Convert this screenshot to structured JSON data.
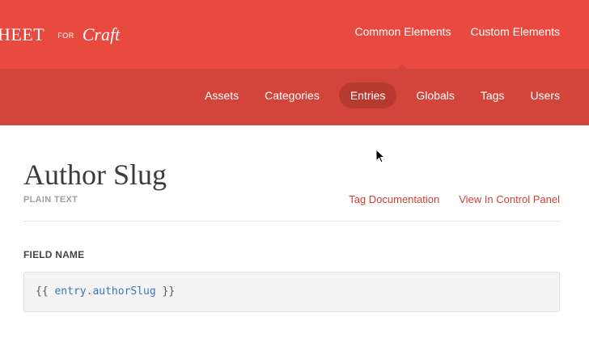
{
  "header": {
    "logo": {
      "main": "HEET",
      "for": "FOR",
      "craft": "Craft"
    },
    "nav": [
      {
        "label": "Common Elements"
      },
      {
        "label": "Custom Elements"
      }
    ]
  },
  "subnav": {
    "items": [
      {
        "label": "Assets"
      },
      {
        "label": "Categories"
      },
      {
        "label": "Entries",
        "active": true
      },
      {
        "label": "Globals"
      },
      {
        "label": "Tags"
      },
      {
        "label": "Users"
      }
    ]
  },
  "content": {
    "title": "Author Slug",
    "type": "PLAIN TEXT",
    "links": [
      {
        "label": "Tag Documentation"
      },
      {
        "label": "View In Control Panel"
      }
    ],
    "field_label": "FIELD NAME",
    "code": {
      "open": "{{",
      "expression": "entry.authorSlug",
      "close": "}}"
    }
  },
  "colors": {
    "header": "#e84a3f",
    "subnav": "#d3453b",
    "active_pill": "#b73a31",
    "link": "#cf4137",
    "code_var": "#3f74b8"
  },
  "icons": {
    "pointer": "mouse-pointer-icon"
  }
}
